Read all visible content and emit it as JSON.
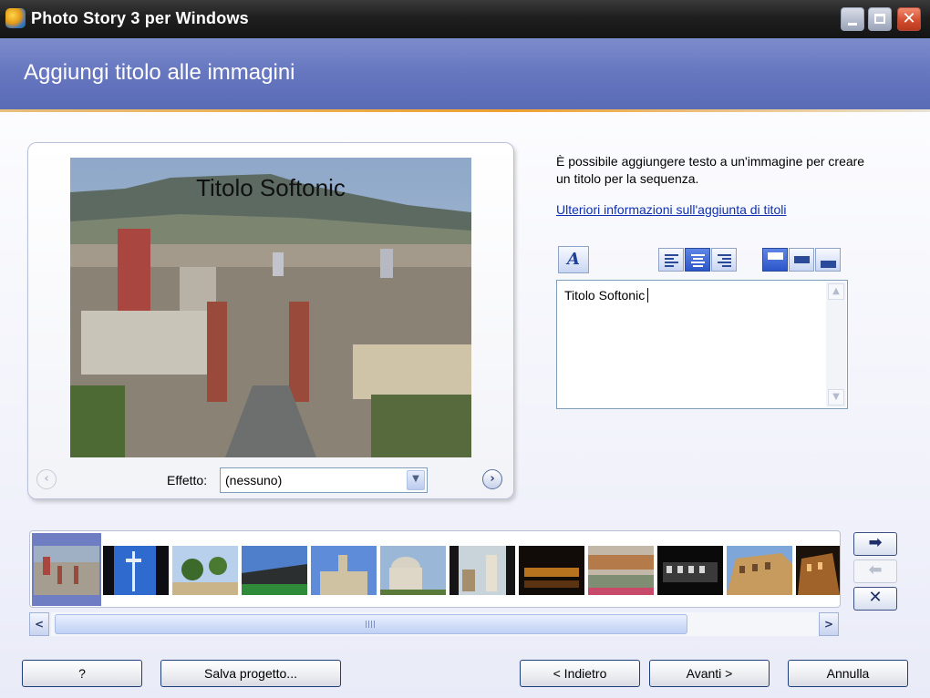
{
  "window": {
    "title": "Photo Story 3 per Windows",
    "close_glyph": "✕"
  },
  "header": {
    "title": "Aggiungi titolo alle immagini"
  },
  "preview": {
    "overlay_title": "Titolo Softonic",
    "effect_label": "Effetto:",
    "effect_value": "(nessuno)",
    "prev_glyph": "‹",
    "next_glyph": "›"
  },
  "panel": {
    "description": "È possibile aggiungere testo a un'immagine per creare un titolo per la sequenza.",
    "help_link": "Ulteriori informazioni sull'aggiunta di titoli",
    "font_button_glyph": "A",
    "text_value": "Titolo Softonic"
  },
  "toolbar": {
    "horizontal_align": [
      "left",
      "center",
      "right"
    ],
    "horizontal_active": "center",
    "vertical_align": [
      "top",
      "middle",
      "bottom"
    ],
    "vertical_active": "top"
  },
  "filmstrip": {
    "thumbnails": [
      {
        "name": "barcelona-cityscape",
        "selected": true
      },
      {
        "name": "communications-tower"
      },
      {
        "name": "palm-trees"
      },
      {
        "name": "stadium"
      },
      {
        "name": "church-facade"
      },
      {
        "name": "domed-baptistery"
      },
      {
        "name": "leaning-tower"
      },
      {
        "name": "bridge-at-night"
      },
      {
        "name": "river-bridge"
      },
      {
        "name": "colosseum-night"
      },
      {
        "name": "colosseum-day"
      },
      {
        "name": "colosseum-night-2"
      }
    ],
    "scroll_left_glyph": "<",
    "scroll_right_glyph": ">",
    "move_right_glyph": "➡",
    "move_left_glyph": "⬅",
    "remove_glyph": "✕"
  },
  "footer": {
    "help_label": "?",
    "save_label": "Salva progetto...",
    "back_label": "< Indietro",
    "next_label": "Avanti >",
    "cancel_label": "Annulla"
  },
  "colors": {
    "header_bg": "#6676bf",
    "accent": "#f0a030",
    "link": "#0f2fb0"
  }
}
